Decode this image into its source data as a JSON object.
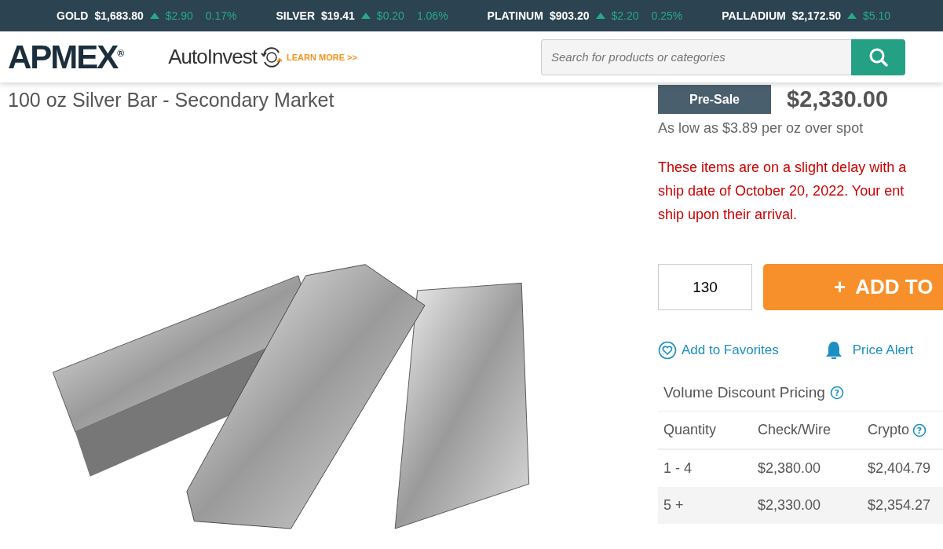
{
  "ticker": [
    {
      "metal": "GOLD",
      "price": "$1,683.80",
      "change": "$2.90",
      "percent": "0.17%"
    },
    {
      "metal": "SILVER",
      "price": "$19.41",
      "change": "$0.20",
      "percent": "1.06%"
    },
    {
      "metal": "PLATINUM",
      "price": "$903.20",
      "change": "$2.20",
      "percent": "0.25%"
    },
    {
      "metal": "PALLADIUM",
      "price": "$2,172.50",
      "change": "$5.10"
    }
  ],
  "header": {
    "logo": "APMEX",
    "logo_mark": "®",
    "autoinvest": "AutoInvest",
    "learn_more": "LEARN MORE >>",
    "search": {
      "placeholder": "Search for products or categories"
    }
  },
  "product": {
    "title": "100 oz Silver Bar - Secondary Market",
    "badge": "Pre-Sale",
    "price": "$2,330.00",
    "as_low_as": "As low as $3.89 per oz over spot",
    "notice_lines": [
      "These items are on a slight delay with a",
      "ship date of October 20, 2022. Your ent",
      "ship upon their arrival."
    ],
    "quantity": "130",
    "add_button": "ADD TO",
    "add_icon": "+",
    "favorites": "Add to Favorites",
    "price_alert": "Price Alert"
  },
  "volume_pricing": {
    "title": "Volume Discount Pricing",
    "help_mark": "?",
    "crypto_help_mark": "?",
    "columns": [
      "Quantity",
      "Check/Wire",
      "Crypto"
    ],
    "rows": [
      {
        "quantity": "1 - 4",
        "check_wire": "$2,380.00",
        "crypto": "$2,404.79"
      },
      {
        "quantity": "5 +",
        "check_wire": "$2,330.00",
        "crypto": "$2,354.27"
      }
    ]
  }
}
